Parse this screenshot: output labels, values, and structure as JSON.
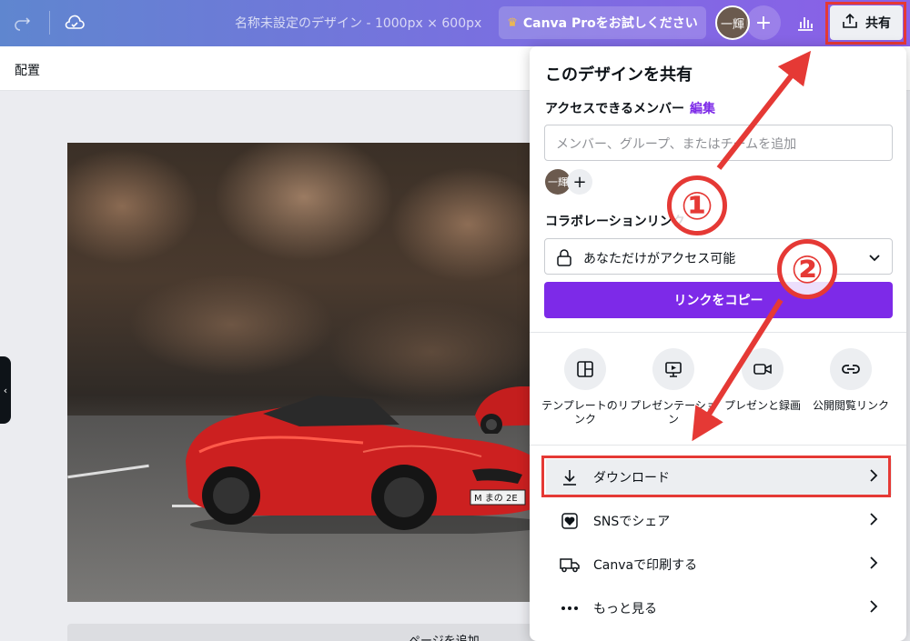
{
  "topbar": {
    "doc_title": "名称未設定のデザイン - 1000px × 600px",
    "pro_button": "Canva Proをお試しください",
    "avatar_label": "一輝",
    "share_label": "共有"
  },
  "subbar": {
    "arrange_label": "配置"
  },
  "canvas": {
    "add_page_label": "ページを追加"
  },
  "share_panel": {
    "title": "このデザインを共有",
    "access_label": "アクセスできるメンバー",
    "edit_link": "編集",
    "member_input_placeholder": "メンバー、グループ、またはチームを追加",
    "member_avatar": "一輝",
    "collab_label": "コラボレーションリンク",
    "access_select": "あなただけがアクセス可能",
    "copy_button": "リンクをコピー",
    "options": [
      {
        "label": "テンプレートのリンク",
        "icon": "template-icon"
      },
      {
        "label": "プレゼンテーション",
        "icon": "presentation-icon"
      },
      {
        "label": "プレゼンと録画",
        "icon": "record-icon"
      },
      {
        "label": "公開閲覧リンク",
        "icon": "link-icon"
      }
    ],
    "rows": [
      {
        "label": "ダウンロード",
        "icon": "download-icon"
      },
      {
        "label": "SNSでシェア",
        "icon": "heart-icon"
      },
      {
        "label": "Canvaで印刷する",
        "icon": "truck-icon"
      },
      {
        "label": "もっと見る",
        "icon": "more-icon"
      }
    ]
  },
  "annotations": {
    "step1": "①",
    "step2": "②"
  },
  "colors": {
    "accent": "#7d2ae8",
    "annotation": "#e53935"
  }
}
